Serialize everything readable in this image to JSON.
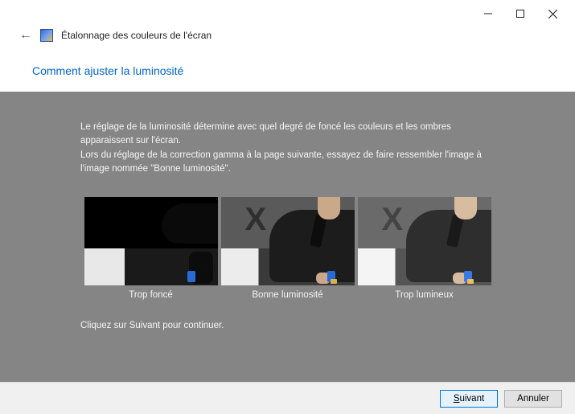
{
  "window": {
    "title": "Étalonnage des couleurs de l'écran"
  },
  "page": {
    "heading": "Comment ajuster la luminosité",
    "description_line1": "Le réglage de la luminosité détermine avec quel degré de foncé les couleurs et les ombres apparaissent sur l'écran.",
    "description_line2": "Lors du réglage de la correction gamma à la page suivante, essayez de faire ressembler l'image à l'image nommée \"Bonne luminosité\".",
    "continue_hint": "Cliquez sur Suivant pour continuer."
  },
  "examples": [
    {
      "caption": "Trop foncé"
    },
    {
      "caption": "Bonne luminosité"
    },
    {
      "caption": "Trop lumineux"
    }
  ],
  "buttons": {
    "next_prefix": "S",
    "next_rest": "uivant",
    "cancel": "Annuler"
  }
}
